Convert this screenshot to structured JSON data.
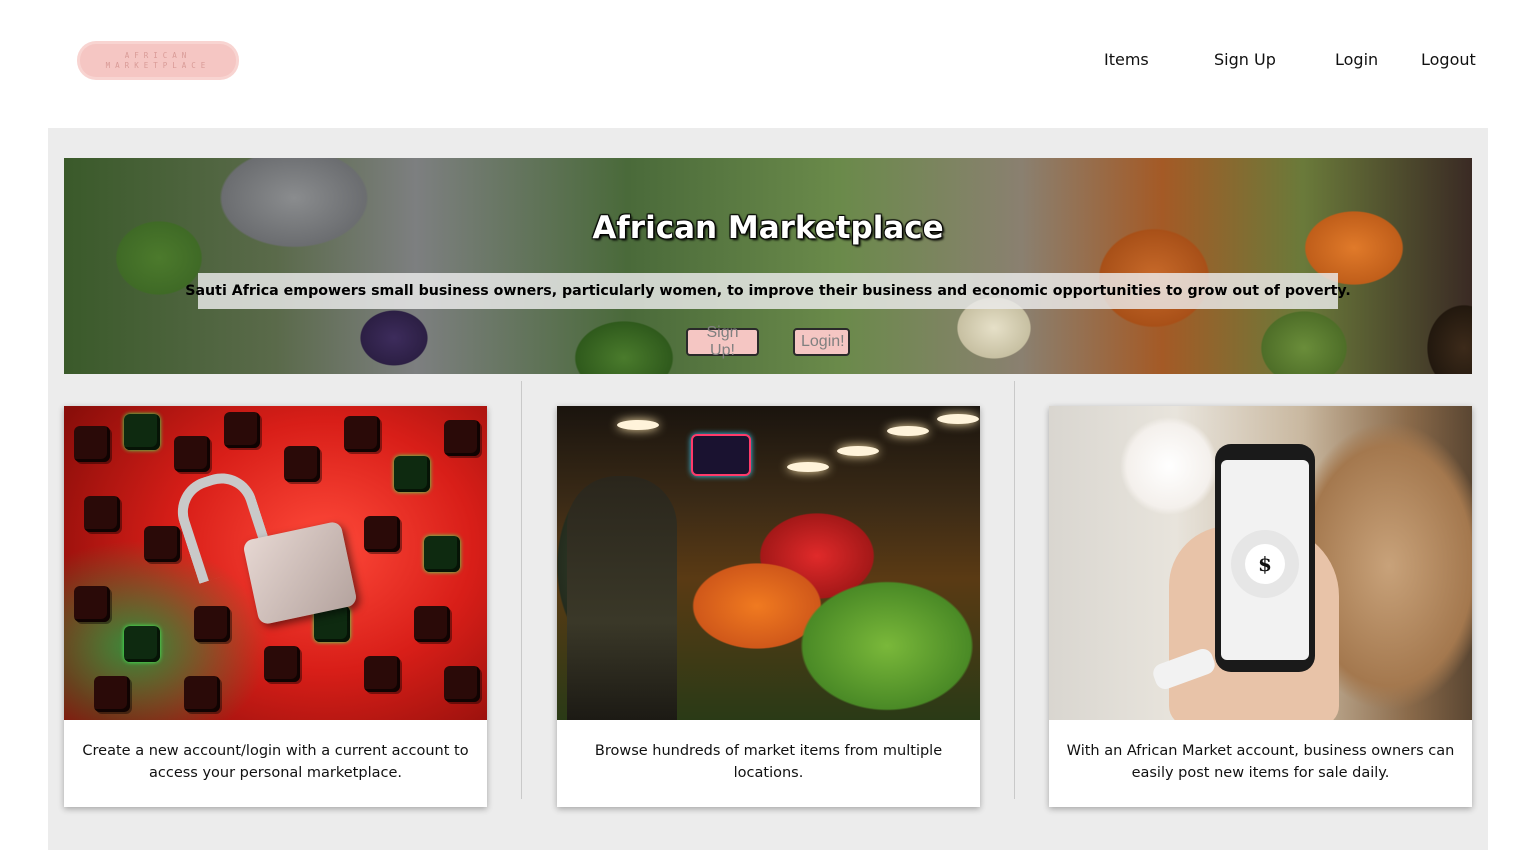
{
  "brand": {
    "logo_line1": "AFRICAN",
    "logo_line2": "MARKETPLACE"
  },
  "nav": {
    "items": "Items",
    "signup": "Sign Up",
    "login": "Login",
    "logout": "Logout"
  },
  "hero": {
    "title": "African Marketplace",
    "subtitle": "Sauti Africa empowers small business owners, particularly women, to improve their business and economic opportunities to grow out of poverty.",
    "signup_button": "Sign Up!",
    "login_button": "Login!"
  },
  "cards": [
    {
      "image": "padlock-keyboard-image",
      "caption": "Create a new account/login with a current account to access your personal marketplace."
    },
    {
      "image": "market-stall-image",
      "caption": "Browse hundreds of market items from multiple locations."
    },
    {
      "image": "phone-payment-image",
      "caption": "With an African Market account, business owners can easily post new items for sale daily."
    }
  ],
  "phone_icon_glyph": "$",
  "colors": {
    "accent_pink": "#f5c6c3",
    "panel_gray": "#ececec",
    "button_text": "#808080"
  }
}
